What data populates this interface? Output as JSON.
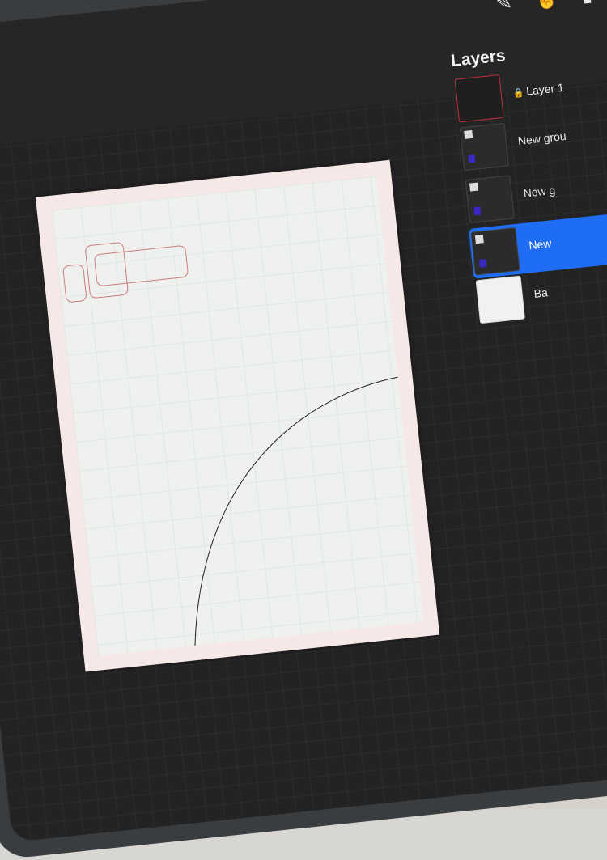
{
  "toolbar": {
    "tools": [
      {
        "name": "brush-icon",
        "glyph": "✎"
      },
      {
        "name": "smudge-icon",
        "glyph": "☝"
      },
      {
        "name": "eraser-icon",
        "glyph": "▮"
      }
    ],
    "transform_glyph": "↗"
  },
  "layers_panel": {
    "title": "Layers",
    "layers": [
      {
        "label": "Layer 1",
        "locked": true,
        "thumb": "red-frame"
      },
      {
        "label": "New grou",
        "thumb": "group"
      },
      {
        "label": "New g",
        "thumb": "group"
      },
      {
        "label": "New",
        "thumb": "group",
        "active": true
      },
      {
        "label": "Ba",
        "thumb": "white"
      }
    ]
  },
  "colors": {
    "accent": "#1f6df5",
    "canvas_margin": "#f7e8e8",
    "canvas_fill": "#eef1ee",
    "shape_stroke": "#cf7c7c"
  }
}
